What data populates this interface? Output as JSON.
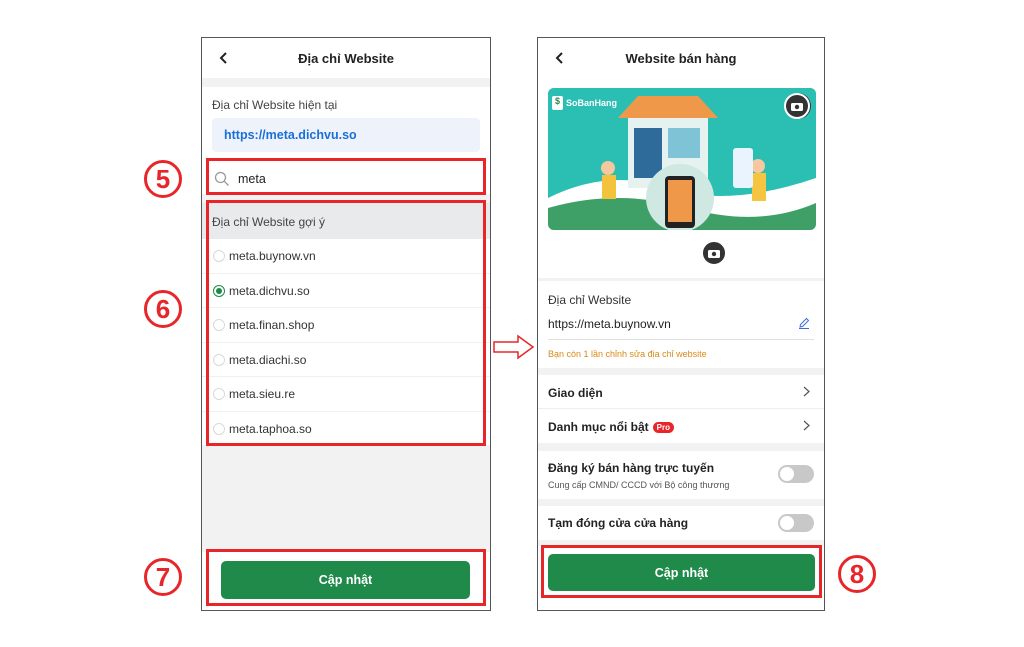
{
  "left": {
    "title": "Địa chỉ Website",
    "current_label": "Địa chỉ Website hiện tại",
    "current_url": "https://meta.dichvu.so",
    "search_value": "meta",
    "suggest_label": "Địa chỉ Website gợi ý",
    "options": [
      {
        "label": "meta.buynow.vn",
        "selected": false
      },
      {
        "label": "meta.dichvu.so",
        "selected": true
      },
      {
        "label": "meta.finan.shop",
        "selected": false
      },
      {
        "label": "meta.diachi.so",
        "selected": false
      },
      {
        "label": "meta.sieu.re",
        "selected": false
      },
      {
        "label": "meta.taphoa.so",
        "selected": false
      }
    ],
    "update_button": "Cập nhật"
  },
  "right": {
    "title": "Website bán hàng",
    "brand": "SoBanHang",
    "website_label": "Địa chỉ Website",
    "website_url": "https://meta.buynow.vn",
    "edit_note": "Bạn còn 1 lần chỉnh sửa địa chỉ website",
    "rows": {
      "theme": "Giao diện",
      "featured": "Danh mục nổi bật",
      "pro_badge": "Pro",
      "register": "Đăng ký bán hàng trực tuyến",
      "register_sub": "Cung cấp CMND/ CCCD với Bộ công thương",
      "close_store": "Tạm đóng cửa cửa hàng"
    },
    "toggles": {
      "register": false,
      "close_store": false
    },
    "update_button": "Cập nhật"
  },
  "annotations": {
    "step5": "5",
    "step6": "6",
    "step7": "7",
    "step8": "8"
  },
  "colors": {
    "accent_green": "#1f8a4a",
    "annotation_red": "#e8262a",
    "link_blue": "#1a6fd8",
    "note_orange": "#d98a17"
  }
}
